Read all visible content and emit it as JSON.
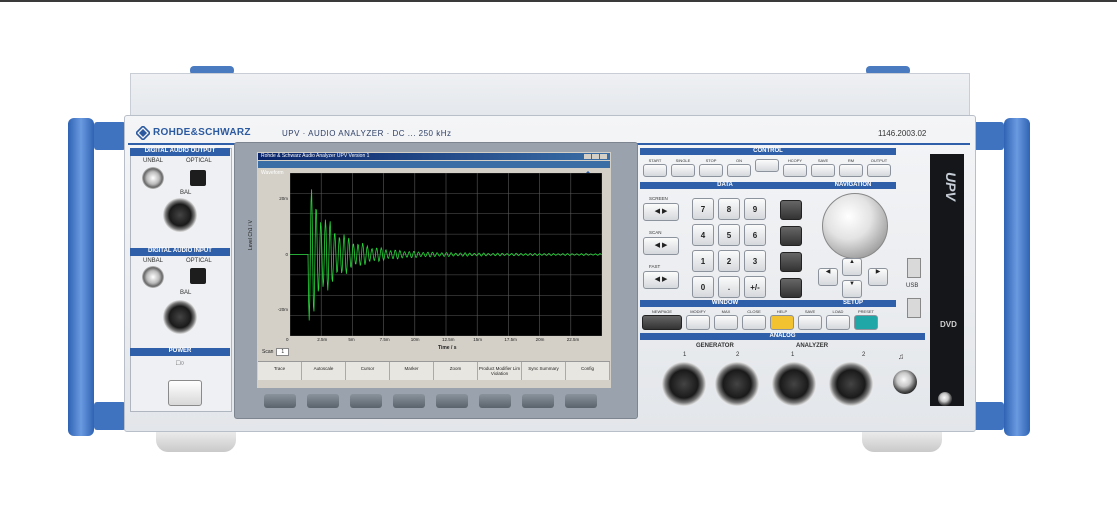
{
  "device": {
    "brand": "ROHDE&SCHWARZ",
    "title": "UPV · AUDIO ANALYZER · DC ... 250 kHz",
    "serial": "1146.2003.02",
    "model_badge": "UPV"
  },
  "left_panel": {
    "digital_output_header": "DIGITAL AUDIO OUTPUT",
    "unbal_label": "UNBAL",
    "optical_label": "OPTICAL",
    "bal_label": "BAL",
    "digital_input_header": "DIGITAL AUDIO INPUT",
    "unbal_label_2": "UNBAL",
    "optical_label_2": "OPTICAL",
    "bal_label_2": "BAL",
    "power_header": "POWER"
  },
  "screen": {
    "window_title": "Rohde & Schwarz Audio Analyzer UPV Version 1",
    "plot_title": "Waveform",
    "y_axis_label": "Level Ch1 / V",
    "x_axis_label": "Time / s",
    "y_ticks": [
      "20m",
      "0",
      "-20m"
    ],
    "x_ticks": [
      "0",
      "2.5m",
      "5m",
      "7.5m",
      "10m",
      "12.5m",
      "15m",
      "17.5m",
      "20m",
      "22.5m"
    ],
    "scale_label": "Scan",
    "scale_value": "1"
  },
  "softkeys": [
    {
      "label": "Trace"
    },
    {
      "label": "Autoscale"
    },
    {
      "label": "Cursor"
    },
    {
      "label": "Marker"
    },
    {
      "label": "Zoom"
    },
    {
      "label": "Product Modifier Lim Violation"
    },
    {
      "label": "Sync Summary"
    },
    {
      "label": "Config"
    }
  ],
  "control_panel": {
    "control_header": "CONTROL",
    "data_header": "DATA",
    "navigation_header": "NAVIGATION",
    "window_header": "WINDOW",
    "setup_header": "SETUP",
    "control_keys": [
      "START",
      "SINGLE",
      "STOP",
      "ON",
      "",
      "HCOPY",
      "SAVE",
      "RM",
      "OUTPUT"
    ],
    "data_keys": [
      "7",
      "8",
      "9",
      "4",
      "5",
      "6",
      "1",
      "2",
      "3",
      "0",
      ".",
      "+/-"
    ],
    "nav_side_keys": [
      "SCREEN",
      "SCAN",
      "FAST"
    ],
    "window_keys": [
      "NEWPAGE",
      "MODIFY",
      "MAX",
      "CLOSE",
      "HELP",
      "SAVE",
      "LOAD",
      "PRESET"
    ],
    "usb_label": "USB",
    "drive_label": "DVD"
  },
  "analog_panel": {
    "analog_header": "ANALOG",
    "generator_label": "GENERATOR",
    "analyzer_label": "ANALYZER",
    "channel_1": "1",
    "channel_2": "2",
    "channel_1b": "1",
    "channel_2b": "2"
  },
  "colors": {
    "brand_blue": "#2f5fa8",
    "handle_blue": "#3f73c0",
    "waveform_green": "#27d43a",
    "help_key_yellow": "#f2c230",
    "preset_key_teal": "#1fa6a6"
  }
}
